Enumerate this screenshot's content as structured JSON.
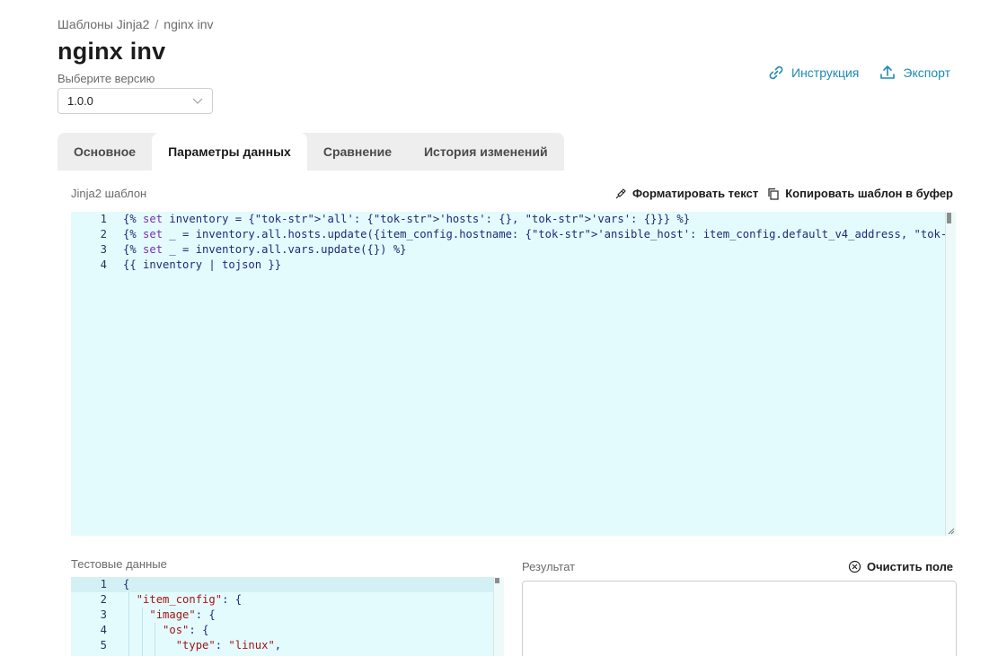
{
  "breadcrumb": {
    "parent": "Шаблоны Jinja2",
    "separator": "/",
    "current": "nginx inv"
  },
  "page": {
    "title": "nginx inv"
  },
  "version": {
    "label": "Выберите версию",
    "selected": "1.0.0"
  },
  "actions": {
    "instruction": "Инструкция",
    "export": "Экспорт"
  },
  "tabs": [
    {
      "label": "Основное"
    },
    {
      "label": "Параметры данных"
    },
    {
      "label": "Сравнение"
    },
    {
      "label": "История изменений"
    }
  ],
  "template_editor": {
    "label": "Jinja2 шаблон",
    "format_label": "Форматировать текст",
    "copy_label": "Копировать шаблон в буфер",
    "line_numbers": [
      "1",
      "2",
      "3",
      "4"
    ],
    "lines": [
      "{% set inventory = {'all': {'hosts': {}, 'vars': {}}} %}",
      "{% set _ = inventory.all.hosts.update({item_config.hostname: {'ansible_host': item_config.default_v4_address, 'machine': item_config}})",
      "{% set _ = inventory.all.vars.update({}) %}",
      "{{ inventory | tojson }}"
    ]
  },
  "test_data": {
    "label": "Тестовые данные",
    "line_numbers": [
      "1",
      "2",
      "3",
      "4",
      "5"
    ],
    "lines": [
      "{",
      "  \"item_config\": {",
      "    \"image\": {",
      "      \"os\": {",
      "        \"type\": \"linux\","
    ]
  },
  "result": {
    "label": "Результат",
    "clear_label": "Очистить поле"
  },
  "colors": {
    "accent": "#1f8ab5",
    "editor_bg": "#e4fbfd",
    "tab_bar": "#eeeeee"
  }
}
